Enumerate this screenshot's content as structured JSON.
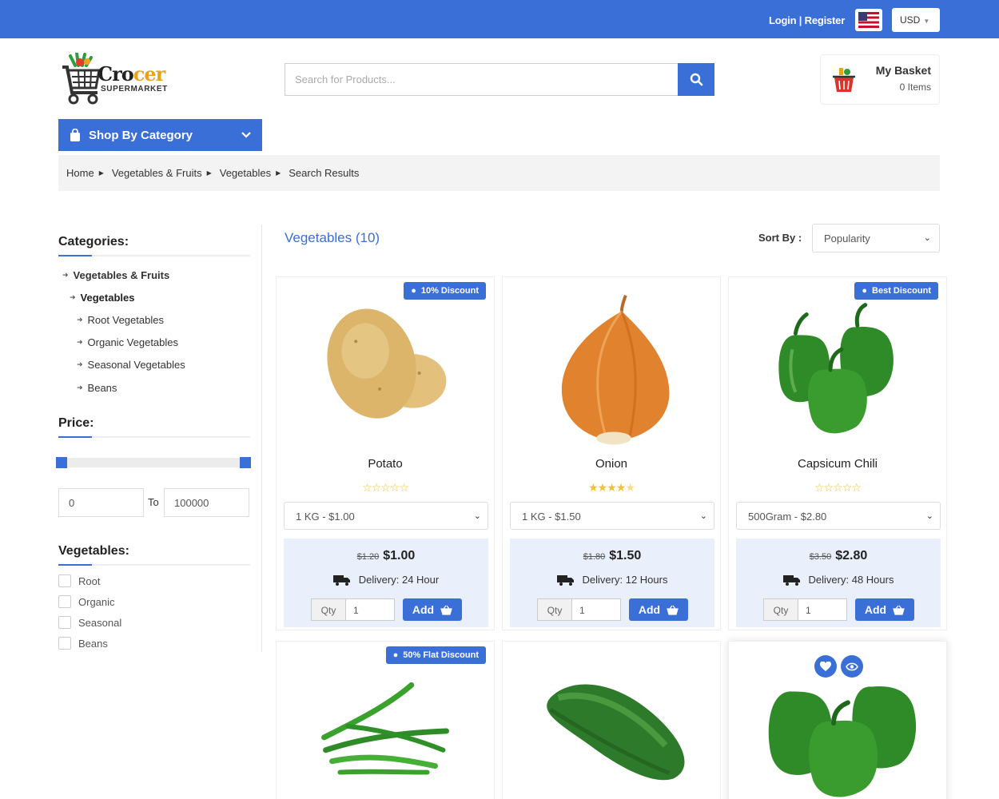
{
  "topbar": {
    "login_label": "Login | Register",
    "currency": "USD"
  },
  "header": {
    "logo_brand_a": "Cro",
    "logo_brand_b": "cer",
    "logo_sub": "SUPERMARKET",
    "search_placeholder": "Search for Products...",
    "basket_title": "My Basket",
    "basket_count": "0 Items"
  },
  "category_button": "Shop By Category",
  "breadcrumb": [
    "Home",
    "Vegetables & Fruits",
    "Vegetables",
    "Search Results"
  ],
  "sidebar": {
    "categories_title": "Categories:",
    "categories": [
      {
        "label": "Vegetables & Fruits"
      },
      {
        "label": "Vegetables"
      },
      {
        "label": "Root Vegetables"
      },
      {
        "label": "Organic Vegetables"
      },
      {
        "label": "Seasonal Vegetables"
      },
      {
        "label": "Beans"
      }
    ],
    "price_title": "Price:",
    "price_min": "0",
    "price_to": "To",
    "price_max": "100000",
    "veg_title": "Vegetables:",
    "veg_filters": [
      "Root",
      "Organic",
      "Seasonal",
      "Beans"
    ]
  },
  "main": {
    "title": "Vegetables (10)",
    "sort_label": "Sort By :",
    "sort_value": "Popularity"
  },
  "products": [
    {
      "name": "Potato",
      "badge": "10% Discount",
      "rating": 0,
      "variant": "1 KG - $1.00",
      "old_price": "$1.20",
      "price": "$1.00",
      "delivery": "Delivery: 24 Hour",
      "qty_label": "Qty",
      "qty": "1",
      "add_label": "Add"
    },
    {
      "name": "Onion",
      "badge": "",
      "rating": 4.5,
      "variant": "1 KG - $1.50",
      "old_price": "$1.80",
      "price": "$1.50",
      "delivery": "Delivery: 12 Hours",
      "qty_label": "Qty",
      "qty": "1",
      "add_label": "Add"
    },
    {
      "name": "Capsicum Chili",
      "badge": "Best Discount",
      "rating": 0,
      "variant": "500Gram - $2.80",
      "old_price": "$3.50",
      "price": "$2.80",
      "delivery": "Delivery: 48 Hours",
      "qty_label": "Qty",
      "qty": "1",
      "add_label": "Add"
    },
    {
      "badge": "50% Flat Discount"
    },
    {
      "badge": ""
    },
    {
      "badge": ""
    }
  ],
  "colors": {
    "accent": "#3a6fd8",
    "star": "#f0c330",
    "price_bg": "#e9effb"
  }
}
